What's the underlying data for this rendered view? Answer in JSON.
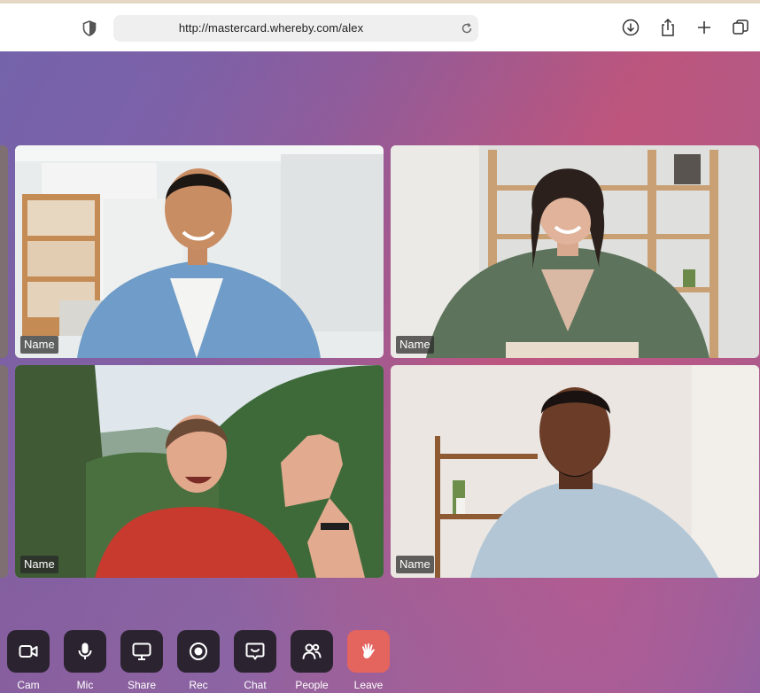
{
  "browser": {
    "url": "http://mastercard.whereby.com/alex",
    "icons": [
      "shield-icon",
      "reload-icon",
      "download-icon",
      "share-icon",
      "new-tab-icon",
      "tabs-icon"
    ]
  },
  "participants": [
    {
      "name": "Name",
      "scene": "man-denim-shirt-office"
    },
    {
      "name": "Name",
      "scene": "woman-green-cardigan-shelves"
    },
    {
      "name": "Name",
      "scene": "woman-waving-forest"
    },
    {
      "name": "Name",
      "scene": "man-patterned-shirt-room"
    }
  ],
  "controls": [
    {
      "label": "Cam",
      "icon": "camera-icon"
    },
    {
      "label": "Mic",
      "icon": "microphone-icon"
    },
    {
      "label": "Share",
      "icon": "screen-share-icon"
    },
    {
      "label": "Rec",
      "icon": "record-icon"
    },
    {
      "label": "Chat",
      "icon": "chat-icon"
    },
    {
      "label": "People",
      "icon": "people-icon"
    },
    {
      "label": "Leave",
      "icon": "wave-hand-icon"
    }
  ],
  "colors": {
    "leave_button": "#e4645e",
    "control_button": "#2b2430",
    "background_purple": "#6f63a6",
    "background_pink": "#b8587f"
  }
}
